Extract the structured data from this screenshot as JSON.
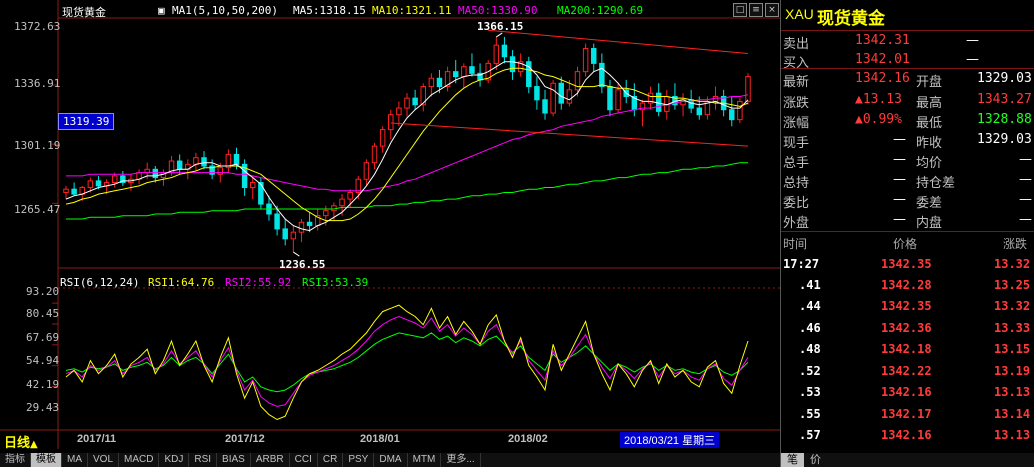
{
  "chart": {
    "symbol_title": "现货黄金",
    "ma_legend": {
      "label": "MA1(5,10,50,200)",
      "ma5": "MA5:1318.15",
      "ma10": "MA10:1321.11",
      "ma50": "MA50:1330.90",
      "ma200": "MA200:1290.69"
    },
    "y_ticks": [
      "1372.63",
      "1336.91",
      "1301.19",
      "1265.47"
    ],
    "price_box": "1319.39",
    "high_annotation": "1366.15",
    "low_annotation": "1236.55",
    "rsi_legend": {
      "label": "RSI(6,12,24)",
      "rsi1": "RSI1:64.76",
      "rsi2": "RSI2:55.92",
      "rsi3": "RSI3:53.39"
    },
    "rsi_ticks": [
      "93.20",
      "80.45",
      "67.69",
      "54.94",
      "42.19",
      "29.43"
    ],
    "period_label": "日线",
    "x_labels": [
      "2017/11",
      "2017/12",
      "2018/01",
      "2018/02"
    ],
    "cursor_date": "2018/03/21 星期三",
    "window_buttons": [
      "□",
      "≡",
      "×"
    ]
  },
  "chart_data": {
    "type": "candlestick",
    "ylim": [
      1230,
      1375
    ],
    "rsi_ylim": [
      18,
      100
    ],
    "note_colors": {
      "up": "#ff2020",
      "down": "#00e5e5",
      "ma5": "#ffffff",
      "ma10": "#ffff00",
      "ma50": "#ff00ff",
      "ma200": "#00ff00",
      "trendline": "#ff2020"
    },
    "ohlc": [
      [
        1272,
        1276,
        1268,
        1274
      ],
      [
        1274,
        1278,
        1270,
        1271
      ],
      [
        1271,
        1276,
        1267,
        1275
      ],
      [
        1275,
        1281,
        1272,
        1279
      ],
      [
        1279,
        1282,
        1274,
        1276
      ],
      [
        1276,
        1280,
        1271,
        1278
      ],
      [
        1278,
        1284,
        1275,
        1282
      ],
      [
        1282,
        1285,
        1276,
        1278
      ],
      [
        1278,
        1283,
        1273,
        1280
      ],
      [
        1280,
        1286,
        1277,
        1284
      ],
      [
        1284,
        1290,
        1280,
        1286
      ],
      [
        1286,
        1288,
        1278,
        1281
      ],
      [
        1281,
        1286,
        1276,
        1284
      ],
      [
        1284,
        1294,
        1282,
        1291
      ],
      [
        1291,
        1295,
        1283,
        1286
      ],
      [
        1286,
        1292,
        1280,
        1289
      ],
      [
        1289,
        1296,
        1285,
        1293
      ],
      [
        1293,
        1297,
        1286,
        1288
      ],
      [
        1288,
        1292,
        1280,
        1283
      ],
      [
        1283,
        1290,
        1278,
        1287
      ],
      [
        1287,
        1298,
        1284,
        1295
      ],
      [
        1295,
        1299,
        1286,
        1289
      ],
      [
        1289,
        1292,
        1270,
        1275
      ],
      [
        1275,
        1282,
        1268,
        1278
      ],
      [
        1278,
        1281,
        1262,
        1265
      ],
      [
        1265,
        1270,
        1255,
        1259
      ],
      [
        1259,
        1264,
        1246,
        1250
      ],
      [
        1250,
        1256,
        1240,
        1244
      ],
      [
        1244,
        1252,
        1236,
        1248
      ],
      [
        1248,
        1256,
        1242,
        1254
      ],
      [
        1254,
        1260,
        1248,
        1252
      ],
      [
        1252,
        1262,
        1249,
        1258
      ],
      [
        1258,
        1264,
        1252,
        1261
      ],
      [
        1261,
        1266,
        1255,
        1264
      ],
      [
        1264,
        1271,
        1258,
        1268
      ],
      [
        1268,
        1274,
        1263,
        1272
      ],
      [
        1272,
        1282,
        1268,
        1280
      ],
      [
        1280,
        1292,
        1276,
        1290
      ],
      [
        1290,
        1302,
        1286,
        1300
      ],
      [
        1300,
        1312,
        1296,
        1310
      ],
      [
        1310,
        1322,
        1304,
        1319
      ],
      [
        1319,
        1327,
        1312,
        1323
      ],
      [
        1323,
        1332,
        1318,
        1329
      ],
      [
        1329,
        1334,
        1322,
        1325
      ],
      [
        1325,
        1338,
        1321,
        1336
      ],
      [
        1336,
        1344,
        1330,
        1341
      ],
      [
        1341,
        1346,
        1332,
        1336
      ],
      [
        1336,
        1348,
        1333,
        1345
      ],
      [
        1345,
        1352,
        1338,
        1342
      ],
      [
        1342,
        1350,
        1335,
        1348
      ],
      [
        1348,
        1356,
        1342,
        1344
      ],
      [
        1344,
        1350,
        1336,
        1340
      ],
      [
        1340,
        1352,
        1338,
        1350
      ],
      [
        1350,
        1366,
        1346,
        1361
      ],
      [
        1361,
        1366,
        1350,
        1354
      ],
      [
        1354,
        1358,
        1340,
        1345
      ],
      [
        1345,
        1356,
        1342,
        1351
      ],
      [
        1351,
        1354,
        1332,
        1336
      ],
      [
        1336,
        1342,
        1322,
        1328
      ],
      [
        1328,
        1334,
        1316,
        1320
      ],
      [
        1320,
        1340,
        1318,
        1338
      ],
      [
        1338,
        1342,
        1322,
        1326
      ],
      [
        1326,
        1340,
        1324,
        1334
      ],
      [
        1334,
        1348,
        1330,
        1345
      ],
      [
        1345,
        1362,
        1342,
        1359
      ],
      [
        1359,
        1362,
        1345,
        1350
      ],
      [
        1350,
        1356,
        1332,
        1336
      ],
      [
        1336,
        1340,
        1318,
        1322
      ],
      [
        1322,
        1338,
        1320,
        1334
      ],
      [
        1334,
        1340,
        1326,
        1330
      ],
      [
        1330,
        1338,
        1318,
        1322
      ],
      [
        1322,
        1328,
        1312,
        1326
      ],
      [
        1326,
        1336,
        1322,
        1332
      ],
      [
        1332,
        1338,
        1318,
        1321
      ],
      [
        1321,
        1334,
        1316,
        1330
      ],
      [
        1330,
        1338,
        1322,
        1325
      ],
      [
        1325,
        1332,
        1318,
        1328
      ],
      [
        1328,
        1334,
        1320,
        1323
      ],
      [
        1323,
        1330,
        1316,
        1319
      ],
      [
        1319,
        1330,
        1316,
        1327
      ],
      [
        1327,
        1336,
        1322,
        1330
      ],
      [
        1330,
        1334,
        1318,
        1322
      ],
      [
        1322,
        1330,
        1312,
        1316
      ],
      [
        1316,
        1329,
        1314,
        1327
      ],
      [
        1327,
        1344,
        1325,
        1342
      ]
    ],
    "ma5": [
      1268,
      1270,
      1271,
      1273,
      1275,
      1276,
      1277,
      1279,
      1279,
      1280,
      1282,
      1282,
      1283,
      1285,
      1286,
      1286,
      1289,
      1290,
      1290,
      1288,
      1288,
      1289,
      1285,
      1281,
      1277,
      1269,
      1262,
      1256,
      1252,
      1250,
      1249,
      1252,
      1254,
      1257,
      1260,
      1265,
      1270,
      1276,
      1283,
      1292,
      1302,
      1310,
      1317,
      1322,
      1326,
      1331,
      1334,
      1337,
      1340,
      1342,
      1343,
      1343,
      1345,
      1348,
      1351,
      1351,
      1350,
      1348,
      1343,
      1336,
      1334,
      1330,
      1328,
      1332,
      1340,
      1345,
      1347,
      1343,
      1338,
      1332,
      1329,
      1327,
      1327,
      1326,
      1325,
      1327,
      1328,
      1326,
      1325,
      1326,
      1327,
      1325,
      1323,
      1323,
      1328
    ],
    "ma10": [
      1265,
      1266,
      1268,
      1269,
      1271,
      1272,
      1273,
      1274,
      1275,
      1276,
      1278,
      1279,
      1280,
      1281,
      1283,
      1284,
      1285,
      1287,
      1287,
      1288,
      1288,
      1288,
      1287,
      1285,
      1283,
      1279,
      1275,
      1271,
      1267,
      1263,
      1260,
      1257,
      1255,
      1255,
      1255,
      1256,
      1259,
      1263,
      1268,
      1274,
      1281,
      1288,
      1295,
      1302,
      1309,
      1315,
      1321,
      1326,
      1331,
      1335,
      1338,
      1340,
      1341,
      1344,
      1346,
      1347,
      1347,
      1346,
      1345,
      1343,
      1342,
      1340,
      1338,
      1336,
      1336,
      1336,
      1337,
      1336,
      1335,
      1335,
      1334,
      1332,
      1330,
      1330,
      1330,
      1329,
      1329,
      1328,
      1327,
      1327,
      1326,
      1326,
      1325,
      1324,
      1326
    ],
    "ma50": [
      1282,
      1282,
      1282,
      1283,
      1283,
      1283,
      1283,
      1283,
      1283,
      1284,
      1284,
      1284,
      1284,
      1284,
      1284,
      1284,
      1284,
      1284,
      1284,
      1284,
      1284,
      1283,
      1283,
      1282,
      1281,
      1280,
      1279,
      1278,
      1277,
      1276,
      1275,
      1274,
      1274,
      1273,
      1273,
      1273,
      1273,
      1273,
      1274,
      1275,
      1276,
      1277,
      1279,
      1280,
      1282,
      1284,
      1286,
      1288,
      1290,
      1292,
      1294,
      1296,
      1298,
      1300,
      1302,
      1304,
      1305,
      1307,
      1308,
      1309,
      1310,
      1312,
      1313,
      1314,
      1315,
      1316,
      1318,
      1319,
      1320,
      1321,
      1322,
      1323,
      1323,
      1324,
      1325,
      1326,
      1327,
      1327,
      1328,
      1328,
      1329,
      1329,
      1330,
      1330,
      1331
    ],
    "ma200": [
      1256,
      1256,
      1256,
      1257,
      1257,
      1257,
      1257,
      1258,
      1258,
      1258,
      1258,
      1259,
      1259,
      1259,
      1260,
      1260,
      1260,
      1260,
      1261,
      1261,
      1261,
      1261,
      1262,
      1262,
      1262,
      1262,
      1262,
      1262,
      1262,
      1262,
      1262,
      1262,
      1262,
      1262,
      1263,
      1263,
      1263,
      1263,
      1264,
      1264,
      1264,
      1265,
      1265,
      1266,
      1266,
      1267,
      1267,
      1268,
      1268,
      1269,
      1270,
      1270,
      1271,
      1271,
      1272,
      1272,
      1273,
      1274,
      1274,
      1275,
      1275,
      1276,
      1277,
      1277,
      1278,
      1279,
      1279,
      1280,
      1281,
      1281,
      1282,
      1283,
      1283,
      1284,
      1284,
      1285,
      1286,
      1286,
      1287,
      1287,
      1288,
      1288,
      1289,
      1290,
      1290
    ],
    "trendlines": [
      {
        "from": [
          52,
          1370
        ],
        "to": [
          84,
          1356
        ]
      },
      {
        "from": [
          40,
          1314
        ],
        "to": [
          84,
          1300
        ]
      }
    ],
    "rsi1": [
      48,
      52,
      45,
      58,
      50,
      55,
      62,
      48,
      56,
      60,
      65,
      50,
      58,
      70,
      55,
      62,
      70,
      55,
      45,
      60,
      72,
      50,
      35,
      45,
      30,
      25,
      22,
      24,
      35,
      45,
      50,
      52,
      55,
      58,
      62,
      65,
      70,
      75,
      82,
      88,
      90,
      92,
      88,
      85,
      80,
      90,
      78,
      85,
      74,
      82,
      76,
      68,
      80,
      86,
      70,
      60,
      72,
      55,
      48,
      40,
      68,
      52,
      62,
      72,
      82,
      62,
      50,
      40,
      56,
      50,
      42,
      52,
      58,
      44,
      56,
      48,
      52,
      45,
      42,
      54,
      58,
      44,
      38,
      55,
      70
    ],
    "rsi2": [
      50,
      52,
      48,
      55,
      52,
      54,
      58,
      50,
      55,
      57,
      60,
      52,
      56,
      64,
      56,
      60,
      64,
      56,
      48,
      58,
      66,
      52,
      40,
      46,
      36,
      32,
      30,
      31,
      38,
      45,
      49,
      51,
      53,
      55,
      58,
      61,
      65,
      70,
      76,
      80,
      83,
      85,
      83,
      81,
      78,
      84,
      76,
      80,
      73,
      78,
      74,
      68,
      76,
      80,
      70,
      62,
      70,
      58,
      52,
      46,
      64,
      55,
      60,
      67,
      74,
      62,
      54,
      47,
      56,
      52,
      47,
      53,
      57,
      48,
      55,
      50,
      52,
      48,
      46,
      53,
      56,
      47,
      43,
      52,
      60
    ],
    "rsi3": [
      52,
      53,
      51,
      54,
      53,
      54,
      56,
      52,
      54,
      55,
      57,
      53,
      55,
      60,
      55,
      58,
      60,
      56,
      50,
      56,
      62,
      53,
      45,
      48,
      42,
      40,
      39,
      40,
      43,
      47,
      50,
      51,
      52,
      53,
      55,
      57,
      60,
      64,
      68,
      71,
      73,
      75,
      74,
      73,
      72,
      75,
      71,
      73,
      69,
      72,
      70,
      67,
      71,
      73,
      68,
      63,
      67,
      60,
      56,
      52,
      62,
      57,
      60,
      63,
      67,
      62,
      57,
      52,
      56,
      54,
      51,
      54,
      56,
      52,
      55,
      52,
      53,
      51,
      50,
      53,
      55,
      51,
      49,
      52,
      57
    ]
  },
  "quote": {
    "code": "XAU",
    "name": "现货黄金",
    "sell_label": "卖出",
    "sell_value": "1342.31",
    "sell_extra": "—",
    "buy_label": "买入",
    "buy_value": "1342.01",
    "buy_extra": "—",
    "latest_label": "最新",
    "latest_value": "1342.16",
    "open_label": "开盘",
    "open_value": "1329.03",
    "change_label": "涨跌",
    "change_value": "▲13.13",
    "high_label": "最高",
    "high_value": "1343.27",
    "pct_label": "涨幅",
    "pct_value": "▲0.99%",
    "low_label": "最低",
    "low_value": "1328.88",
    "current_hand_label": "现手",
    "current_hand_value": "—",
    "prev_close_label": "昨收",
    "prev_close_value": "1329.03",
    "total_hand_label": "总手",
    "total_hand_value": "—",
    "avg_label": "均价",
    "avg_value": "—",
    "total_hold_label": "总持",
    "total_hold_value": "—",
    "hold_diff_label": "持仓差",
    "hold_diff_value": "—",
    "ratio_label": "委比",
    "ratio_value": "—",
    "diff_label": "委差",
    "diff_value": "—",
    "outer_label": "外盘",
    "outer_value": "—",
    "inner_label": "内盘",
    "inner_value": "—"
  },
  "ticks": {
    "headers": [
      "时间",
      "价格",
      "涨跌"
    ],
    "rows": [
      [
        "17:27",
        "1342.35",
        "13.32"
      ],
      [
        ".41",
        "1342.28",
        "13.25"
      ],
      [
        ".44",
        "1342.35",
        "13.32"
      ],
      [
        ".46",
        "1342.36",
        "13.33"
      ],
      [
        ".48",
        "1342.18",
        "13.15"
      ],
      [
        ".52",
        "1342.22",
        "13.19"
      ],
      [
        ".53",
        "1342.16",
        "13.13"
      ],
      [
        ".55",
        "1342.17",
        "13.14"
      ],
      [
        ".57",
        "1342.16",
        "13.13"
      ]
    ]
  },
  "toolbar": {
    "tabs": [
      "指标",
      "模板",
      "MA",
      "VOL",
      "MACD",
      "KDJ",
      "RSI",
      "BIAS",
      "ARBR",
      "CCI",
      "CR",
      "PSY",
      "DMA",
      "MTM",
      "更多..."
    ],
    "right_tabs": [
      "笔",
      "价"
    ]
  }
}
